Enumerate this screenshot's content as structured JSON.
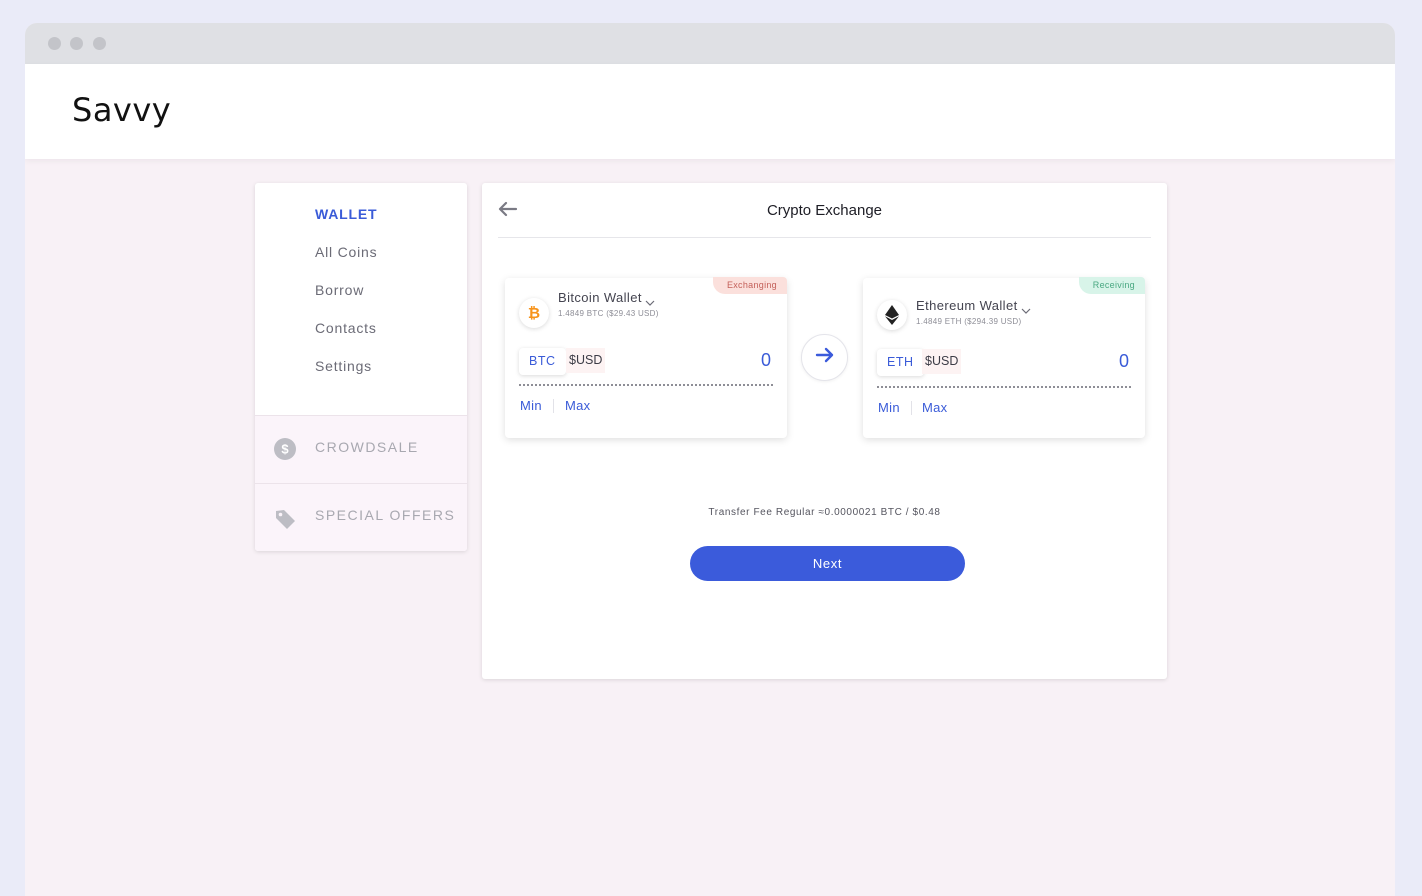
{
  "app": {
    "brand": "Savvy"
  },
  "sidebar": {
    "items": [
      {
        "label": "WALLET",
        "active": true
      },
      {
        "label": "All Coins"
      },
      {
        "label": "Borrow"
      },
      {
        "label": "Contacts"
      },
      {
        "label": "Settings"
      }
    ],
    "sections": [
      {
        "label": "CROWDSALE",
        "icon": "dollar-coin-icon"
      },
      {
        "label": "SPECIAL OFFERS",
        "icon": "tag-icon"
      }
    ]
  },
  "exchange": {
    "title": "Crypto Exchange",
    "from": {
      "badge": "Exchanging",
      "wallet_name": "Bitcoin Wallet",
      "balance": "1.4849 BTC ($29.43 USD)",
      "currency": "BTC",
      "alt_currency": "$USD",
      "amount": "0",
      "min_label": "Min",
      "max_label": "Max",
      "icon": "bitcoin-icon"
    },
    "to": {
      "badge": "Receiving",
      "wallet_name": "Ethereum Wallet",
      "balance": "1.4849 ETH ($294.39 USD)",
      "currency": "ETH",
      "alt_currency": "$USD",
      "amount": "0",
      "min_label": "Min",
      "max_label": "Max",
      "icon": "ethereum-icon"
    },
    "fee": "Transfer Fee Regular ≈0.0000021 BTC / $0.48",
    "next_label": "Next"
  },
  "colors": {
    "accent": "#3b5bdb",
    "exchanging_badge": "#fbe0dc",
    "receiving_badge": "#d8f4e9",
    "bitcoin": "#f7931a"
  }
}
